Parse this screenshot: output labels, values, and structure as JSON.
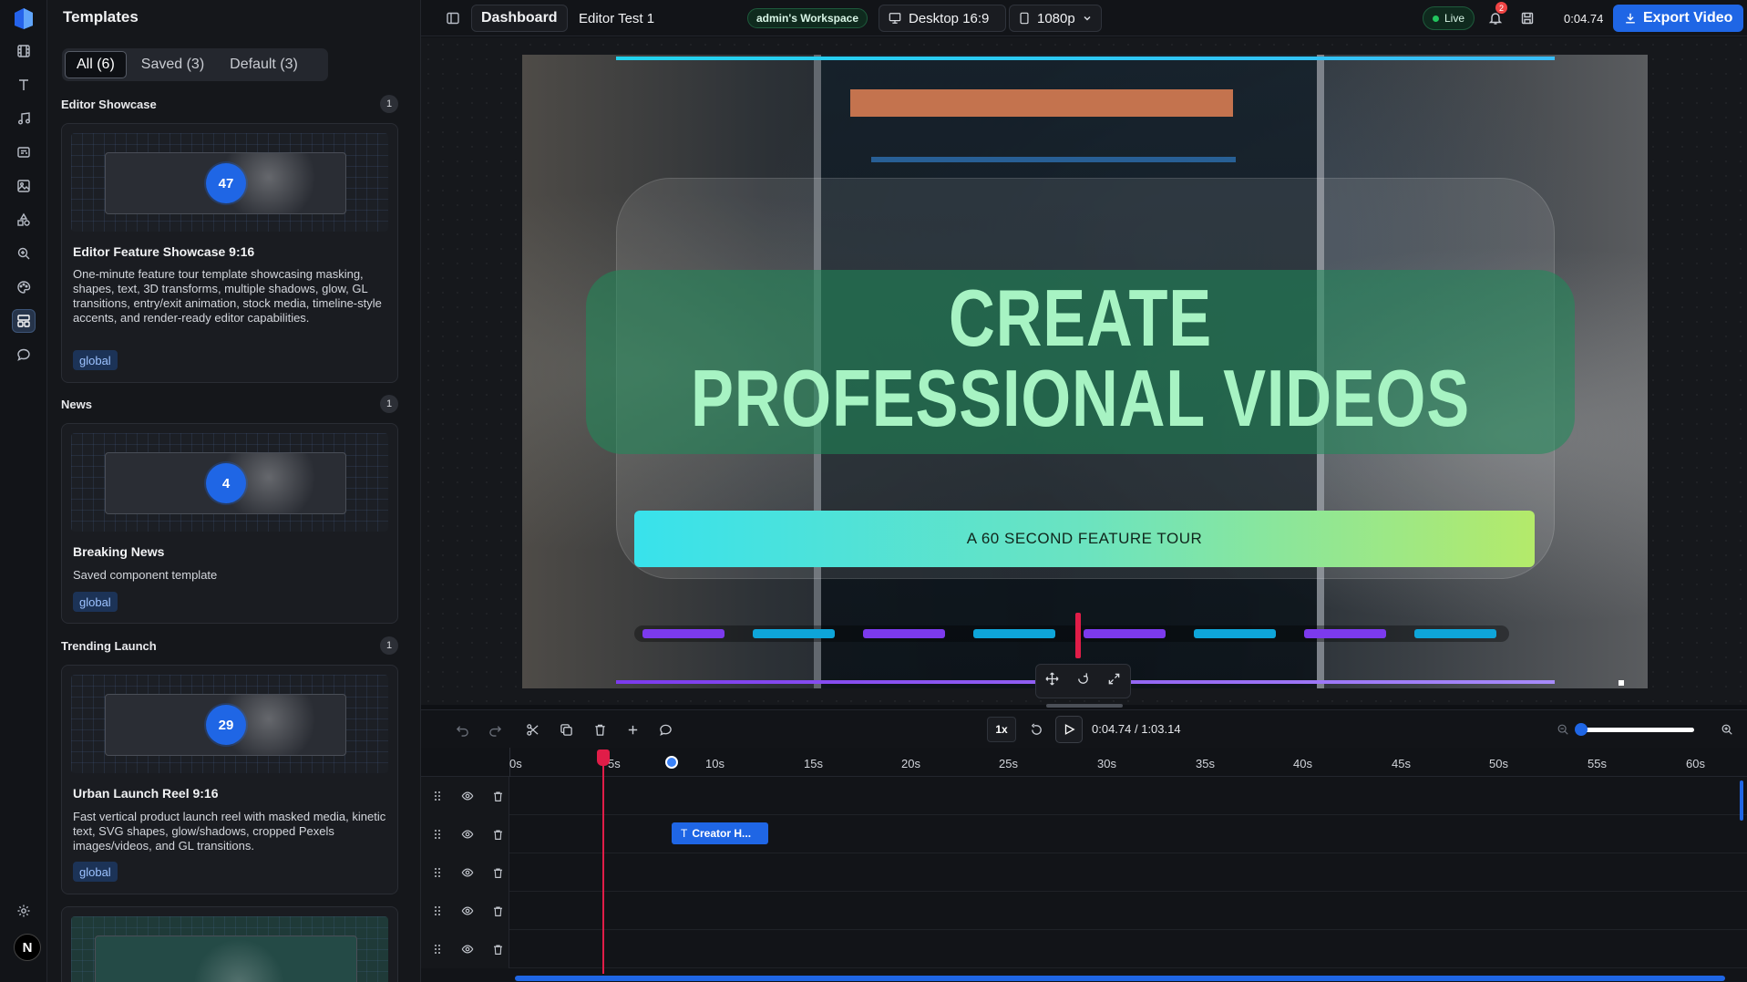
{
  "panel": {
    "title": "Templates",
    "filters": [
      "All (6)",
      "Saved (3)",
      "Default (3)"
    ],
    "sections": [
      {
        "name": "Editor Showcase",
        "count": "1",
        "card": {
          "badge": "47",
          "title": "Editor Feature Showcase 9:16",
          "description": "One-minute feature tour template showcasing masking, shapes, text, 3D transforms, multiple shadows, glow, GL transitions, entry/exit animation, stock media, timeline-style accents, and render-ready editor capabilities.",
          "tag": "global"
        }
      },
      {
        "name": "News",
        "count": "1",
        "card": {
          "badge": "4",
          "title": "Breaking News",
          "description": "Saved component template",
          "tag": "global"
        }
      },
      {
        "name": "Trending Launch",
        "count": "1",
        "card": {
          "badge": "29",
          "title": "Urban Launch Reel 9:16",
          "description": "Fast vertical product launch reel with masked media, kinetic text, SVG shapes, glow/shadows, cropped Pexels images/videos, and GL transitions.",
          "tag": "global"
        }
      }
    ]
  },
  "topbar": {
    "dashboard": "Dashboard",
    "project_name": "Editor Test 1",
    "workspace": "admin's Workspace",
    "device": "Desktop 16:9",
    "resolution": "1080p",
    "live": "Live",
    "notifications": "2",
    "time": "0:04.74",
    "export": "Export Video"
  },
  "video": {
    "headline_line1": "CREATE",
    "headline_line2": "PROFESSIONAL VIDEOS",
    "cta": "A 60 SECOND FEATURE TOUR"
  },
  "timeline": {
    "speed": "1x",
    "time_readout": "0:04.74 / 1:03.14",
    "ruler_ticks": [
      "0s",
      "5s",
      "10s",
      "15s",
      "20s",
      "25s",
      "30s",
      "35s",
      "40s",
      "45s",
      "50s",
      "55s",
      "60s"
    ],
    "clip_label": "Creator H..."
  },
  "colors": {
    "accent": "#1f66e5",
    "playhead": "#e11d48",
    "headline": "#a7f3c3",
    "live": "#22c55e"
  }
}
